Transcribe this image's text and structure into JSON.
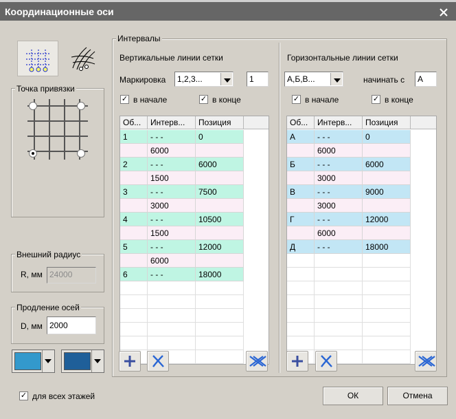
{
  "window": {
    "title": "Координационные оси",
    "colors": {
      "titlebar": "#666666",
      "body": "#d4d0c8"
    }
  },
  "left_panel": {
    "anchor_group_label": "Точка привязки",
    "outer_radius": {
      "group_label": "Внешний радиус",
      "field_label": "R, мм",
      "value": "24000"
    },
    "axis_extension": {
      "group_label": "Продление осей",
      "field_label": "D, мм",
      "value": "2000"
    },
    "colors": {
      "color1": "#3399cc",
      "color2": "#1f5f99"
    }
  },
  "intervals": {
    "group_label": "Интервалы",
    "vertical": {
      "title": "Вертикальные линии сетки",
      "marking_label": "Маркировка",
      "marking_value": "1,2,3...",
      "start_value": "1",
      "at_start_label": "в начале",
      "at_end_label": "в конце",
      "headers": [
        "Об...",
        "Интерв...",
        "Позиция"
      ],
      "rows": [
        {
          "axis": "1",
          "interval": "- - -",
          "position": "0"
        },
        {
          "axis": "",
          "interval": "6000",
          "position": ""
        },
        {
          "axis": "2",
          "interval": "- - -",
          "position": "6000"
        },
        {
          "axis": "",
          "interval": "1500",
          "position": ""
        },
        {
          "axis": "3",
          "interval": "- - -",
          "position": "7500"
        },
        {
          "axis": "",
          "interval": "3000",
          "position": ""
        },
        {
          "axis": "4",
          "interval": "- - -",
          "position": "10500"
        },
        {
          "axis": "",
          "interval": "1500",
          "position": ""
        },
        {
          "axis": "5",
          "interval": "- - -",
          "position": "12000"
        },
        {
          "axis": "",
          "interval": "6000",
          "position": ""
        },
        {
          "axis": "6",
          "interval": "- - -",
          "position": "18000"
        }
      ],
      "axis_row_color": "#bff5e3",
      "interval_row_color": "#fbeef6"
    },
    "horizontal": {
      "title": "Горизонтальные линии сетки",
      "marking_value": "А,Б,В...",
      "start_label": "начинать с",
      "start_value": "А",
      "at_start_label": "в начале",
      "at_end_label": "в конце",
      "headers": [
        "Об...",
        "Интерв...",
        "Позиция"
      ],
      "rows": [
        {
          "axis": "А",
          "interval": "- - -",
          "position": "0"
        },
        {
          "axis": "",
          "interval": "6000",
          "position": ""
        },
        {
          "axis": "Б",
          "interval": "- - -",
          "position": "6000"
        },
        {
          "axis": "",
          "interval": "3000",
          "position": ""
        },
        {
          "axis": "В",
          "interval": "- - -",
          "position": "9000"
        },
        {
          "axis": "",
          "interval": "3000",
          "position": ""
        },
        {
          "axis": "Г",
          "interval": "- - -",
          "position": "12000"
        },
        {
          "axis": "",
          "interval": "6000",
          "position": ""
        },
        {
          "axis": "Д",
          "interval": "- - -",
          "position": "18000"
        }
      ],
      "axis_row_color": "#c2e6f5",
      "interval_row_color": "#fbeef6"
    }
  },
  "footer": {
    "all_floors_label": "для всех этажей",
    "ok_label": "ОК",
    "cancel_label": "Отмена"
  }
}
